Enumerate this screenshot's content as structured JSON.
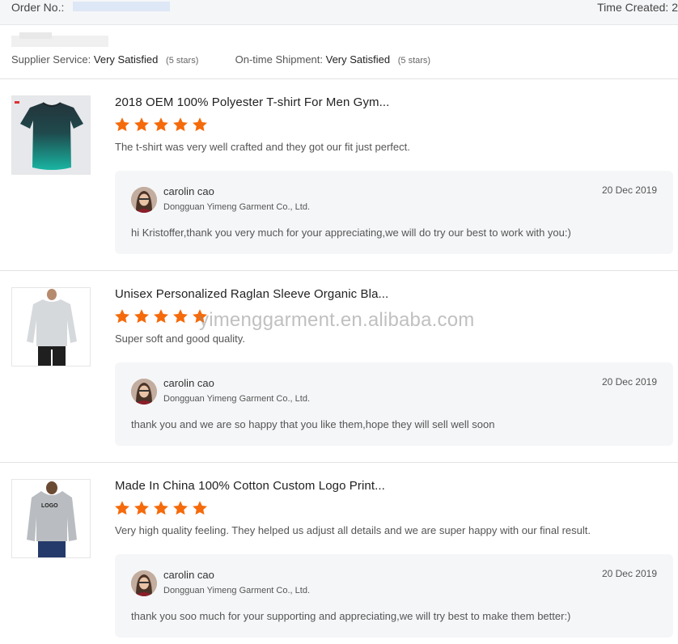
{
  "header": {
    "order_label": "Order No.:",
    "time_label": "Time Created: 2"
  },
  "ratings": {
    "supplier_label": "Supplier Service:",
    "supplier_value": "Very Satisfied",
    "supplier_stars": "(5 stars)",
    "shipment_label": "On-time Shipment:",
    "shipment_value": "Very Satisfied",
    "shipment_stars": "(5 stars)"
  },
  "colors": {
    "star": "#f56a0a",
    "reply_bg": "#f5f6f8"
  },
  "reviews": [
    {
      "title": "2018 OEM 100% Polyester T-shirt For Men Gym...",
      "rating": 5,
      "comment": "The t-shirt was very well crafted and they got our fit just perfect.",
      "image_icon": "tshirt-icon",
      "reply": {
        "name": "carolin cao",
        "company": "Dongguan Yimeng Garment Co., Ltd.",
        "date": "20 Dec 2019",
        "text": "hi Kristoffer,thank you very much for your appreciating,we will do try our best to work with you:)"
      }
    },
    {
      "title": "Unisex Personalized Raglan Sleeve Organic Bla...",
      "rating": 5,
      "comment": "Super soft and good quality.",
      "image_icon": "sweatshirt-icon",
      "reply": {
        "name": "carolin cao",
        "company": "Dongguan Yimeng Garment Co., Ltd.",
        "date": "20 Dec 2019",
        "text": "thank you and we are so happy that you like them,hope they will sell well soon"
      }
    },
    {
      "title": "Made In China 100% Cotton Custom Logo Print...",
      "rating": 5,
      "comment": "Very high quality feeling. They helped us adjust all details and we are super happy with our final result.",
      "image_icon": "hoodie-icon",
      "image_text": "LOGO",
      "reply": {
        "name": "carolin cao",
        "company": "Dongguan Yimeng Garment Co., Ltd.",
        "date": "20 Dec 2019",
        "text": "thank you soo much for your supporting and appreciating,we will try best to make them better:)"
      }
    }
  ],
  "watermark": "yimenggarment.en.alibaba.com"
}
